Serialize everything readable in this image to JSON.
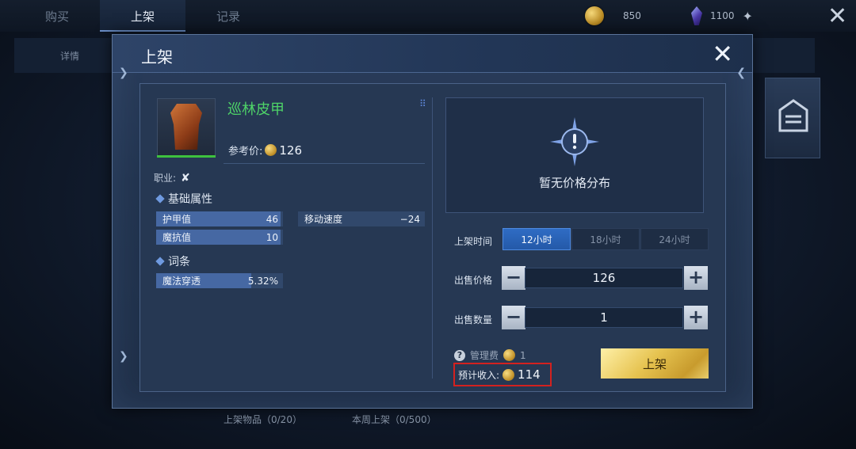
{
  "top_tabs": {
    "buy": "购买",
    "sell": "上架",
    "records": "记录"
  },
  "currency": {
    "gold": "850",
    "gem": "1100"
  },
  "background": {
    "detail_label": "详情",
    "listed_items": "上架物品（0/20）",
    "weekly_listed": "本周上架（0/500）"
  },
  "modal": {
    "title": "上架",
    "item": {
      "name": "巡林皮甲",
      "ref_price_label": "参考价:",
      "ref_price": "126",
      "job_label": "职业:"
    },
    "basic_attrs": {
      "heading": "基础属性",
      "stats": [
        {
          "label": "护甲值",
          "value": "46",
          "fill": 0.98
        },
        {
          "label": "移动速度",
          "value": "−24",
          "fill": 0.0
        },
        {
          "label": "魔抗值",
          "value": "10",
          "fill": 0.98
        }
      ]
    },
    "affixes": {
      "heading": "词条",
      "stats": [
        {
          "label": "魔法穿透",
          "value": "5.32%",
          "fill": 0.75
        }
      ]
    },
    "price_distribution": {
      "empty_text": "暂无价格分布"
    },
    "listing_time": {
      "label": "上架时间",
      "options": [
        "12小时",
        "18小时",
        "24小时"
      ],
      "selected": "12小时"
    },
    "sell_price": {
      "label": "出售价格",
      "value": "126"
    },
    "sell_quantity": {
      "label": "出售数量",
      "value": "1"
    },
    "fee": {
      "label": "管理费",
      "value": "1"
    },
    "income": {
      "label": "预计收入:",
      "value": "114"
    },
    "confirm_label": "上架"
  },
  "colors": {
    "item_name": "#4ed368",
    "highlight_box": "#d3211f",
    "selected_tab": "#2f6cc4",
    "confirm_button": "#e6c350"
  }
}
